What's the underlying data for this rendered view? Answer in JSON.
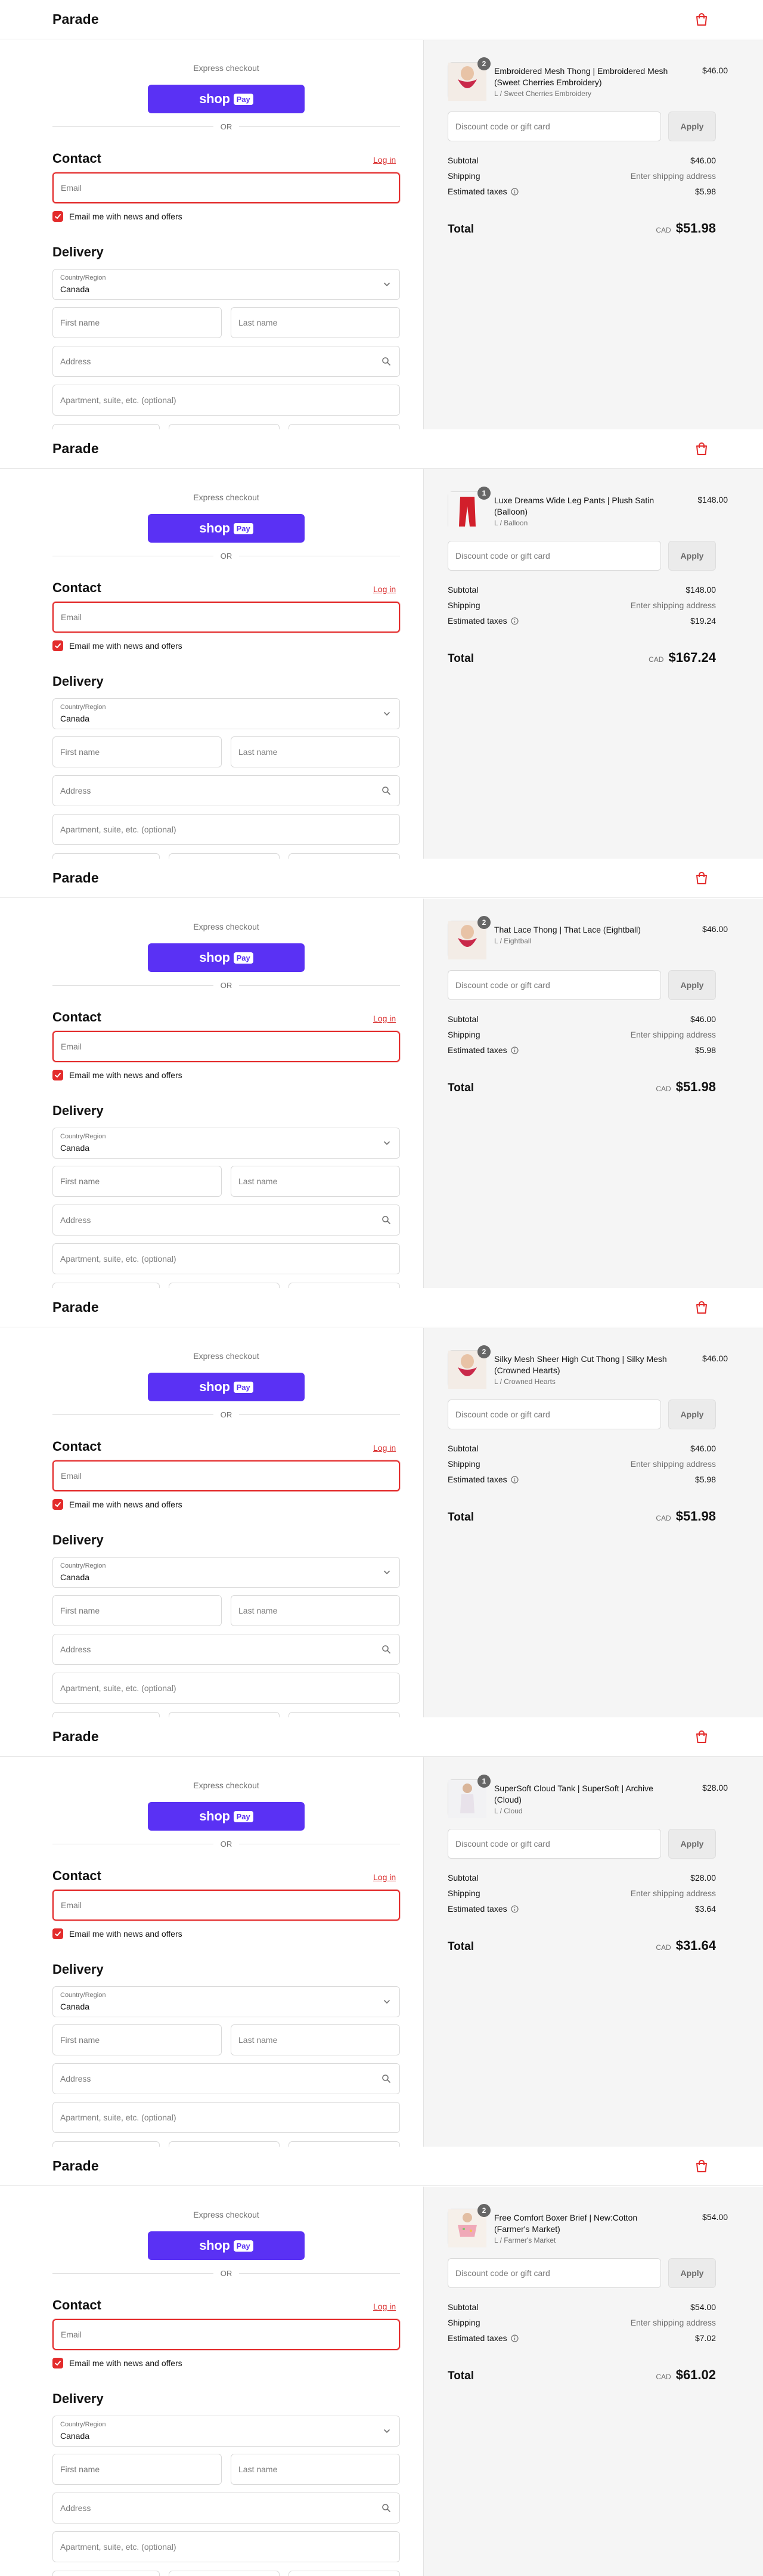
{
  "brand": "Parade",
  "express": {
    "label": "Express checkout",
    "shop": "shop",
    "pay": "Pay"
  },
  "or_label": "OR",
  "contact": {
    "title": "Contact",
    "login": "Log in",
    "email_placeholder": "Email",
    "newsletter": "Email me with news and offers"
  },
  "delivery": {
    "title": "Delivery",
    "country_label": "Country/Region",
    "country_value": "Canada",
    "first_placeholder": "First name",
    "last_placeholder": "Last name",
    "address_placeholder": "Address",
    "apt_placeholder": "Apartment, suite, etc. (optional)"
  },
  "summary_labels": {
    "discount_placeholder": "Discount code or gift card",
    "apply": "Apply",
    "subtotal": "Subtotal",
    "shipping": "Shipping",
    "shipping_value": "Enter shipping address",
    "taxes": "Estimated taxes",
    "total": "Total",
    "currency": "CAD"
  },
  "colors": {
    "accent": "#e32b2b",
    "shop_pay": "#5a31f4",
    "summary_bg": "#f5f5f5"
  },
  "orders": [
    {
      "product_title": "Embroidered Mesh Thong | Embroidered Mesh (Sweet Cherries Embroidery)",
      "variant": "L / Sweet Cherries Embroidery",
      "qty": "2",
      "price": "$46.00",
      "subtotal": "$46.00",
      "taxes": "$5.98",
      "total": "$51.98",
      "image": "panty-image"
    },
    {
      "product_title": "Luxe Dreams Wide Leg Pants | Plush Satin (Balloon)",
      "variant": "L / Balloon",
      "qty": "1",
      "price": "$148.00",
      "subtotal": "$148.00",
      "taxes": "$19.24",
      "total": "$167.24",
      "image": "pants-image"
    },
    {
      "product_title": "That Lace Thong | That Lace (Eightball)",
      "variant": "L / Eightball",
      "qty": "2",
      "price": "$46.00",
      "subtotal": "$46.00",
      "taxes": "$5.98",
      "total": "$51.98",
      "image": "panty-image"
    },
    {
      "product_title": "Silky Mesh Sheer High Cut Thong | Silky Mesh (Crowned Hearts)",
      "variant": "L / Crowned Hearts",
      "qty": "2",
      "price": "$46.00",
      "subtotal": "$46.00",
      "taxes": "$5.98",
      "total": "$51.98",
      "image": "panty-image"
    },
    {
      "product_title": "SuperSoft Cloud Tank | SuperSoft | Archive (Cloud)",
      "variant": "L / Cloud",
      "qty": "1",
      "price": "$28.00",
      "subtotal": "$28.00",
      "taxes": "$3.64",
      "total": "$31.64",
      "image": "tank-image"
    },
    {
      "product_title": "Free Comfort Boxer Brief | New:Cotton (Farmer's Market)",
      "variant": "L / Farmer's Market",
      "qty": "2",
      "price": "$54.00",
      "subtotal": "$54.00",
      "taxes": "$7.02",
      "total": "$61.02",
      "image": "brief-image"
    }
  ]
}
